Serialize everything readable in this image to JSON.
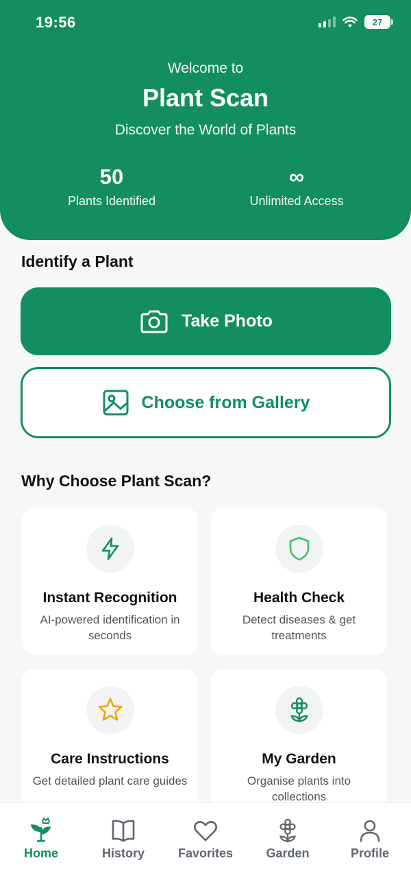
{
  "status_bar": {
    "time": "19:56",
    "battery": "27"
  },
  "header": {
    "welcome": "Welcome to",
    "title": "Plant Scan",
    "subtitle": "Discover the World of Plants",
    "stats": [
      {
        "value": "50",
        "label": "Plants Identified"
      },
      {
        "value": "∞",
        "label": "Unlimited Access"
      }
    ]
  },
  "identify": {
    "title": "Identify a Plant",
    "take_photo": "Take Photo",
    "gallery": "Choose from Gallery"
  },
  "features": {
    "title": "Why Choose Plant Scan?",
    "cards": [
      {
        "title": "Instant Recognition",
        "desc": "AI-powered identification in seconds",
        "icon": "lightning-icon"
      },
      {
        "title": "Health Check",
        "desc": "Detect diseases & get treatments",
        "icon": "shield-icon"
      },
      {
        "title": "Care Instructions",
        "desc": "Get detailed plant care guides",
        "icon": "star-icon"
      },
      {
        "title": "My Garden",
        "desc": "Organise plants into collections",
        "icon": "flower-icon"
      }
    ]
  },
  "tabbar": {
    "tabs": [
      {
        "label": "Home",
        "icon": "home-plant-icon",
        "active": true
      },
      {
        "label": "History",
        "icon": "book-icon",
        "active": false
      },
      {
        "label": "Favorites",
        "icon": "heart-icon",
        "active": false
      },
      {
        "label": "Garden",
        "icon": "flower-icon",
        "active": false
      },
      {
        "label": "Profile",
        "icon": "user-icon",
        "active": false
      }
    ]
  },
  "colors": {
    "brand": "#138e60",
    "star": "#f0a500",
    "shield": "#3fbf6a"
  }
}
